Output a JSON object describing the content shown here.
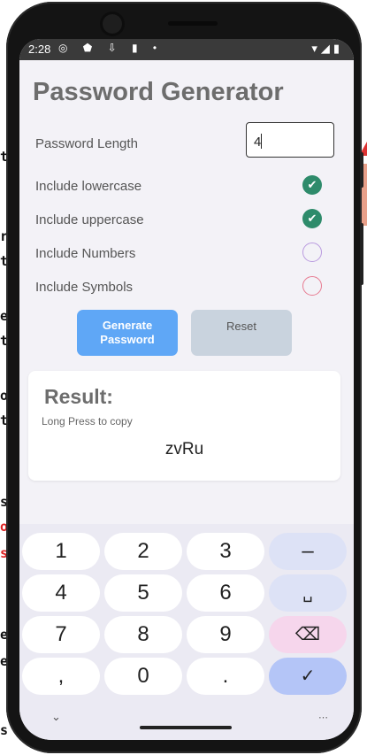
{
  "status_bar": {
    "time": "2:28",
    "left_icons": "◎ ⬟ ⇩ ▮ •",
    "right_icons": "▾◢▮"
  },
  "app": {
    "title": "Password Generator",
    "length_label": "Password Length",
    "length_value": "4",
    "options": [
      {
        "label": "Include lowercase",
        "checked": true
      },
      {
        "label": "Include uppercase",
        "checked": true
      },
      {
        "label": "Include Numbers",
        "checked": false
      },
      {
        "label": "Include Symbols",
        "checked": false
      }
    ],
    "generate_label": "Generate Password",
    "reset_label": "Reset",
    "result": {
      "title": "Result:",
      "hint": "Long Press to copy",
      "value": "zvRu"
    }
  },
  "keyboard": {
    "rows": [
      [
        "1",
        "2",
        "3",
        "–"
      ],
      [
        "4",
        "5",
        "6",
        "␣"
      ],
      [
        "7",
        "8",
        "9",
        "⌫"
      ],
      [
        ",",
        "0",
        ".",
        "✓"
      ]
    ],
    "hide_glyph": "⌄",
    "switch_glyph": "⋯"
  },
  "background": {
    "code_chars": [
      "t",
      "r",
      "t",
      "e",
      "t",
      "o",
      "t",
      "s",
      "o",
      "s",
      "e",
      "e",
      "s"
    ]
  },
  "colors": {
    "checked": "#2e8b6b",
    "generate": "#5fa7f6",
    "reset": "#c9d3de",
    "enter_key": "#b4c5f7"
  }
}
